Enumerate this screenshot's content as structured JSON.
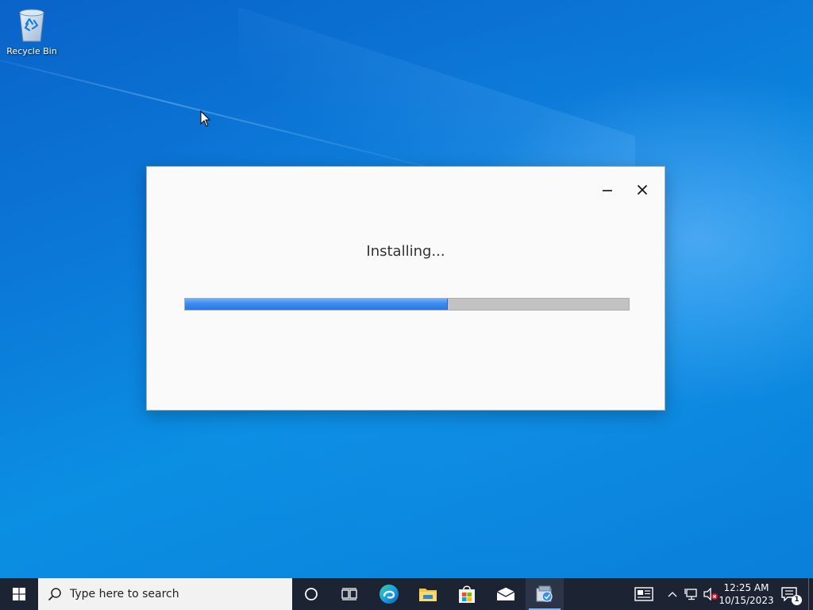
{
  "desktop": {
    "icons": [
      {
        "label": "Recycle Bin",
        "icon": "recycle-bin-icon"
      }
    ]
  },
  "installer": {
    "status_text": "Installing...",
    "progress_percent": 59,
    "controls": {
      "minimize": "minimize-icon",
      "close": "close-icon"
    }
  },
  "taskbar": {
    "search_placeholder": "Type here to search",
    "pinned": [
      {
        "name": "cortana",
        "icon": "cortana-circle-icon"
      },
      {
        "name": "task-view",
        "icon": "task-view-icon"
      },
      {
        "name": "edge",
        "icon": "edge-icon"
      },
      {
        "name": "file-explorer",
        "icon": "folder-icon"
      },
      {
        "name": "microsoft-store",
        "icon": "store-icon"
      },
      {
        "name": "mail",
        "icon": "mail-icon"
      },
      {
        "name": "installer-app",
        "icon": "installer-app-icon",
        "active": true
      }
    ],
    "tray": {
      "time": "12:25 AM",
      "date": "10/15/2023",
      "notification_count": "1"
    }
  },
  "colors": {
    "taskbar_bg": "#1c2333",
    "progress_fill": "#3a8df0",
    "progress_track": "#c2c2c2",
    "window_bg": "#fafafa"
  }
}
